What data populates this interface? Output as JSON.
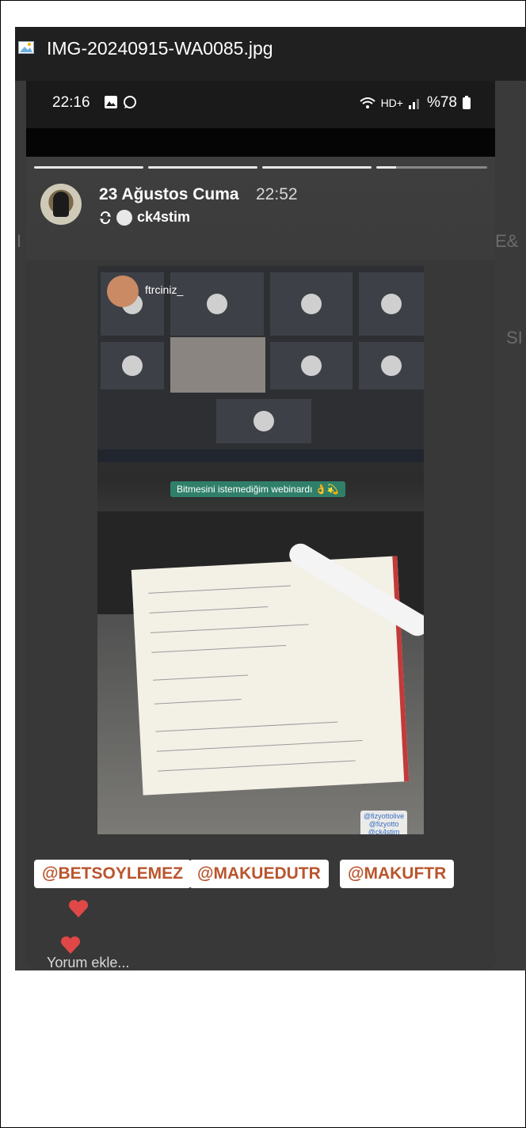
{
  "window": {
    "filename": "IMG-20240915-WA0085.jpg"
  },
  "status_bar": {
    "time": "22:16",
    "battery": "%78",
    "network": "HD+"
  },
  "story": {
    "date": "23 Ağustos Cuma",
    "time": "22:52",
    "reposted_from": "ck4stim",
    "photo_username": "ftrciniz_",
    "caption": "Bitmesini istemediğim webinardı 👌💫",
    "small_tags": [
      "@fizyottolive",
      "@fizyotto",
      "@ck4stim"
    ],
    "mentions": [
      "@BETSOYLEMEZ",
      "@MAKUEDUTR",
      "@MAKUFTR"
    ],
    "comment_placeholder": "Yorum ekle..."
  },
  "colors": {
    "mention_text": "#b9552d",
    "heart": "#e04848",
    "viewer_bg": "#2b2b2b"
  }
}
